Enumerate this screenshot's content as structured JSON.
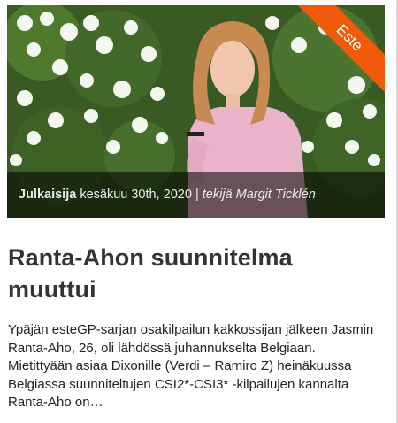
{
  "post": {
    "category_badge": "Este",
    "meta": {
      "published_label": "Julkaisija",
      "date": "kesäkuu 30th, 2020",
      "separator": "|",
      "author_prefix": "tekijä",
      "author": "Margit Ticklén"
    },
    "title": "Ranta-Ahon suunnitelma muuttui",
    "excerpt": "Ypäjän esteGP-sarjan osakilpailun kakkossijan jälkeen Jasmin Ranta-Aho, 26, oli lähdössä juhannukselta Belgiaan. Mietittyään asiaa Dixonille (Verdi – Ramiro Z) heinäkuussa Belgiassa suunniteltujen CSI2*-CSI3* -kilpailujen kannalta Ranta-Aho on…"
  },
  "colors": {
    "badge": "#f25a0b",
    "title": "#333333",
    "meta_overlay": "rgba(0,0,0,0.55)"
  }
}
